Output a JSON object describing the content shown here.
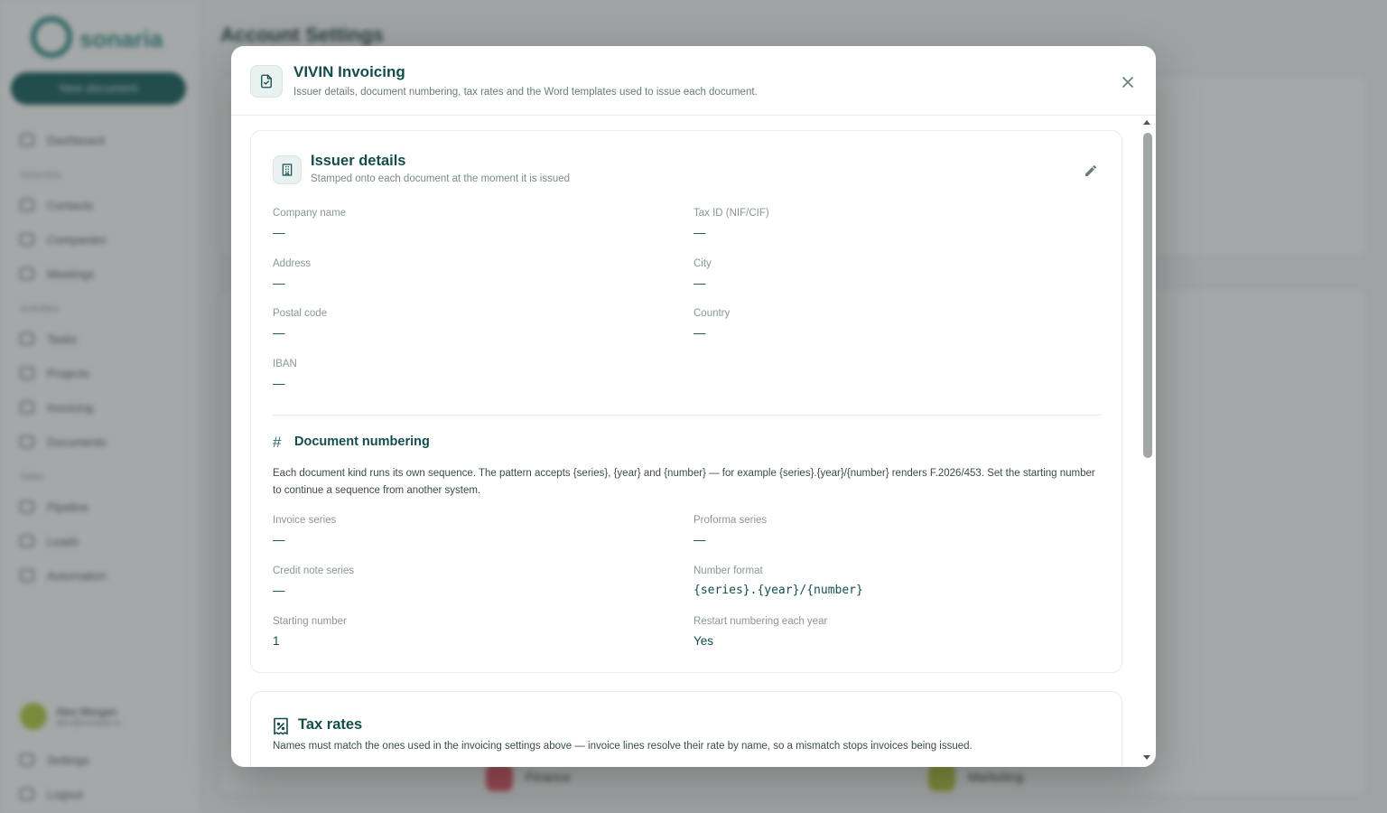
{
  "background": {
    "logo_text": "sonaria",
    "new_button": "New document",
    "page_title": "Account Settings",
    "nav": [
      "Dashboard",
      "Overview",
      "Contacts",
      "Companies",
      "Meetings",
      "Activities",
      "Tasks",
      "Projects",
      "Invoicing",
      "Documents",
      "Sales",
      "Pipeline",
      "Leads",
      "Automation"
    ],
    "nav_groups": [
      "Overview",
      "Activities",
      "Sales"
    ],
    "user_name": "Alex Morgan",
    "user_email": "alex@sonaria.io",
    "footer_nav": [
      "Settings",
      "Logout"
    ],
    "bottom_items": [
      "Finance",
      "Marketing"
    ]
  },
  "modal": {
    "title": "VIVIN Invoicing",
    "subtitle": "Issuer details, document numbering, tax rates and the Word templates used to issue each document.",
    "icons": {
      "header": "document-check-icon",
      "close": "close-icon",
      "issuer": "building-icon",
      "edit": "pencil-icon",
      "numbering": "hash-icon",
      "tax": "receipt-percent-icon"
    },
    "issuer": {
      "title": "Issuer details",
      "subtitle": "Stamped onto each document at the moment it is issued",
      "fields": {
        "company_name": {
          "label": "Company name",
          "value": "—"
        },
        "tax_id": {
          "label": "Tax ID (NIF/CIF)",
          "value": "—"
        },
        "address": {
          "label": "Address",
          "value": "—"
        },
        "city": {
          "label": "City",
          "value": "—"
        },
        "postal_code": {
          "label": "Postal code",
          "value": "—"
        },
        "country": {
          "label": "Country",
          "value": "—"
        },
        "iban": {
          "label": "IBAN",
          "value": "—"
        }
      }
    },
    "numbering": {
      "hash": "#",
      "title": "Document numbering",
      "description": "Each document kind runs its own sequence. The pattern accepts {series}, {year} and {number} — for example {series}.{year}/{number} renders F.2026/453. Set the starting number to continue a sequence from another system.",
      "fields": {
        "invoice_series": {
          "label": "Invoice series",
          "value": "—"
        },
        "proforma_series": {
          "label": "Proforma series",
          "value": "—"
        },
        "credit_note_series": {
          "label": "Credit note series",
          "value": "—"
        },
        "number_format": {
          "label": "Number format",
          "value": "{series}.{year}/{number}"
        },
        "starting_number": {
          "label": "Starting number",
          "value": "1"
        },
        "restart_yearly": {
          "label": "Restart numbering each year",
          "value": "Yes"
        }
      }
    },
    "tax": {
      "title": "Tax rates",
      "description": "Names must match the ones used in the invoicing settings above — invoice lines resolve their rate by name, so a mismatch stops invoices being issued."
    }
  },
  "colors": {
    "accent": "#134e4c",
    "accent_light": "#e9f2f1",
    "muted_text": "#8a9696",
    "overlay": "rgba(55,62,62,0.45)"
  }
}
